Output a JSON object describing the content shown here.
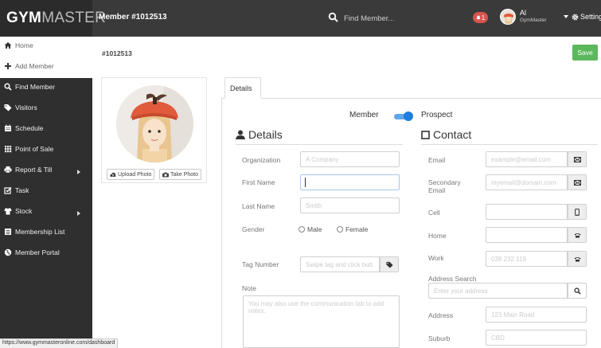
{
  "header": {
    "brand_bold": "GYM",
    "brand_light": "MASTER",
    "member_title": "Member #1012513",
    "search_placeholder": "Find Member...",
    "alert_count": "1",
    "user_name": "Al",
    "user_org": "GymMaster",
    "settings_label": "Settings"
  },
  "sidebar": {
    "items": [
      {
        "label": "Home",
        "icon": "home-icon"
      },
      {
        "label": "Add Member",
        "icon": "plus-icon"
      },
      {
        "label": "Find Member",
        "icon": "search-icon"
      },
      {
        "label": "Visitors",
        "icon": "tag-icon"
      },
      {
        "label": "Schedule",
        "icon": "calendar-icon"
      },
      {
        "label": "Point of Sale",
        "icon": "grid-icon"
      },
      {
        "label": "Report & Till",
        "icon": "printer-icon"
      },
      {
        "label": "Task",
        "icon": "task-icon"
      },
      {
        "label": "Stock",
        "icon": "tshirt-icon"
      },
      {
        "label": "Membership List",
        "icon": "list-icon"
      },
      {
        "label": "Member Portal",
        "icon": "globe-icon"
      }
    ]
  },
  "main": {
    "member_id": "#1012513",
    "save_label": "Save",
    "upload_photo": "Upload Photo",
    "take_photo": "Take Photo",
    "tab_details": "Details",
    "toggle_member": "Member",
    "toggle_prospect": "Prospect",
    "toggle_state": "prospect"
  },
  "details": {
    "heading": "Details",
    "organization_label": "Organization",
    "organization_placeholder": "A Company",
    "first_name_label": "First Name",
    "first_name_value": "",
    "last_name_label": "Last Name",
    "last_name_placeholder": "Smith",
    "gender_label": "Gender",
    "gender_male": "Male",
    "gender_female": "Female",
    "tag_label": "Tag Number",
    "tag_placeholder": "Swipe tag and click butt",
    "note_label": "Note",
    "note_placeholder": "You may also use the communication tab to add notes."
  },
  "contact": {
    "heading": "Contact",
    "email_label": "Email",
    "email_placeholder": "example@email.com",
    "secondary_label_1": "Secondary",
    "secondary_label_2": "Email",
    "secondary_placeholder": "myemail@domain.com",
    "cell_label": "Cell",
    "home_label": "Home",
    "work_label": "Work",
    "work_placeholder": "038 232 119",
    "address_search_label": "Address Search",
    "address_search_placeholder": "Enter your address",
    "address_label": "Address",
    "address_placeholder": "123 Main Road",
    "suburb_label": "Suburb",
    "suburb_placeholder": "CBD"
  },
  "status_url": "https://www.gymmasteronline.com/dashboard",
  "colors": {
    "topbar": "#3a3a3a",
    "sidebar": "#2f2f2f",
    "save": "#5cb85c",
    "toggle": "#1f7ee0",
    "alert": "#d9534f"
  }
}
